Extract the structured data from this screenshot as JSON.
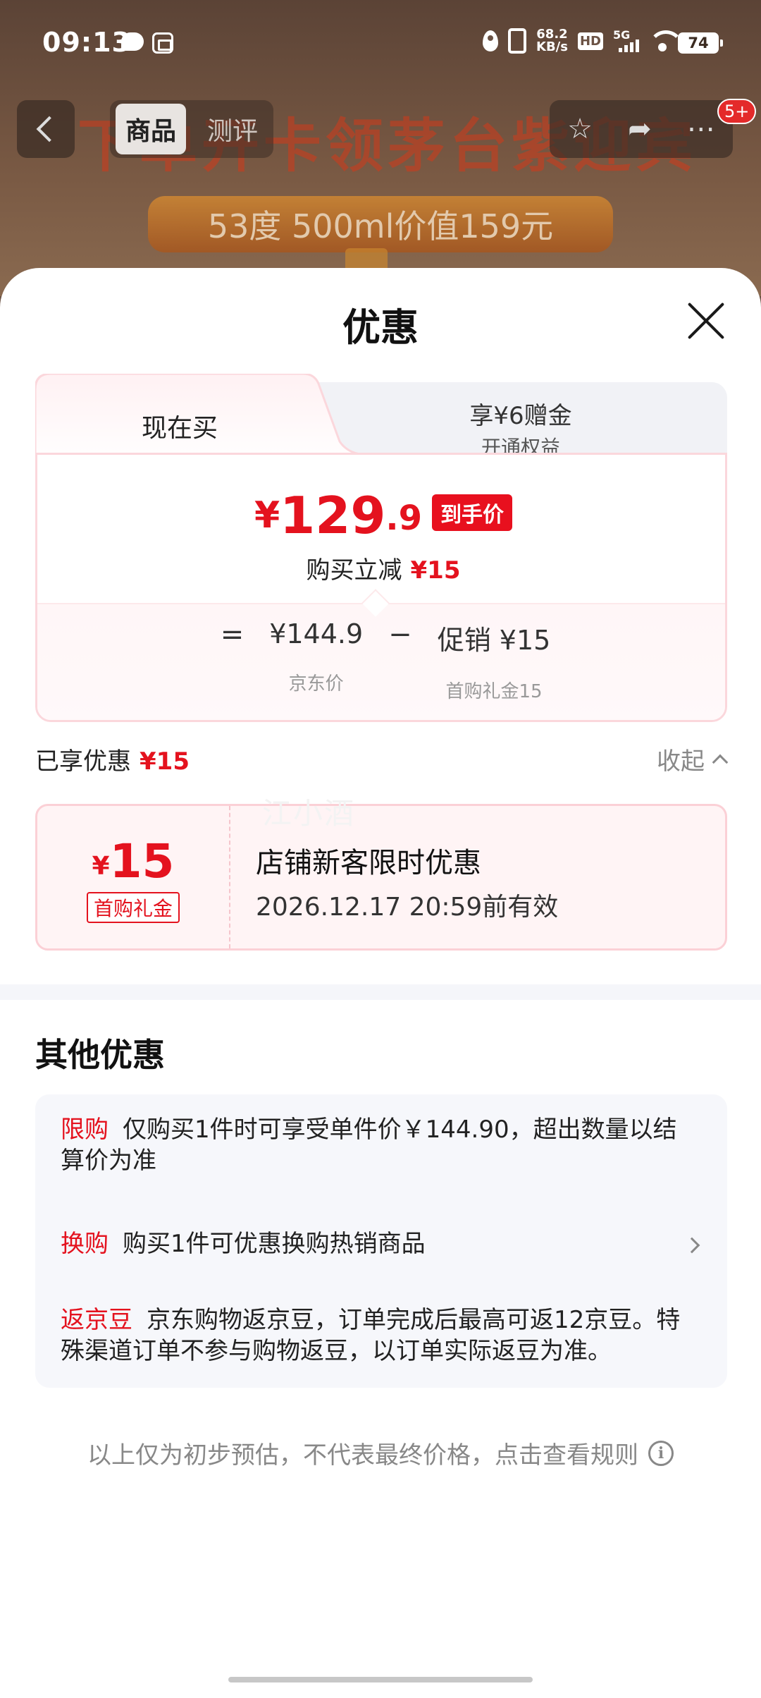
{
  "status_bar": {
    "time": "09:13",
    "net_speed_value": "68.2",
    "net_speed_unit": "KB/s",
    "hd": "HD",
    "signal": "5G",
    "battery": "74"
  },
  "background": {
    "banner_title": "下单开卡领茅台紫迎宾",
    "banner_pill": "53度 500ml价值159元",
    "tabs": [
      "商品",
      "测评"
    ],
    "badge": "5+"
  },
  "sheet": {
    "title": "优惠",
    "tab_now": "现在买",
    "tab_vip_main": "享¥6赠金",
    "tab_vip_sub": "开通权益",
    "final_price": {
      "symbol": "¥",
      "integer": "129",
      "decimal": ".9",
      "tag": "到手价"
    },
    "reduce_label": "购买立减",
    "reduce_value": "¥15",
    "formula": {
      "eq": "=",
      "jd_price": "¥144.9",
      "jd_price_label": "京东价",
      "minus": "−",
      "promo": "促销 ¥15",
      "promo_label": "首购礼金15"
    },
    "enjoyed_label": "已享优惠",
    "enjoyed_value": "¥15",
    "collapse_label": "收起",
    "coupon": {
      "symbol": "¥",
      "amount": "15",
      "tag": "首购礼金",
      "title": "店铺新客限时优惠",
      "valid": "2026.12.17 20:59前有效"
    },
    "watermark": "江小酒",
    "other_title": "其他优惠",
    "other_rows": [
      {
        "tag": "限购",
        "text": "仅购买1件时可享受单件价￥144.90，超出数量以结算价为准"
      },
      {
        "tag": "换购",
        "text": "购买1件可优惠换购热销商品"
      },
      {
        "tag": "返京豆",
        "text": "京东购物返京豆，订单完成后最高可返12京豆。特殊渠道订单不参与购物返豆，以订单实际返豆为准。"
      }
    ],
    "disclaimer": "以上仅为初步预估，不代表最终价格，点击查看规则",
    "info_glyph": "i"
  },
  "colors": {
    "accent_red": "#e4121e",
    "coupon_bg": "#fff4f5",
    "tab_bg": "#f1f2f6"
  }
}
